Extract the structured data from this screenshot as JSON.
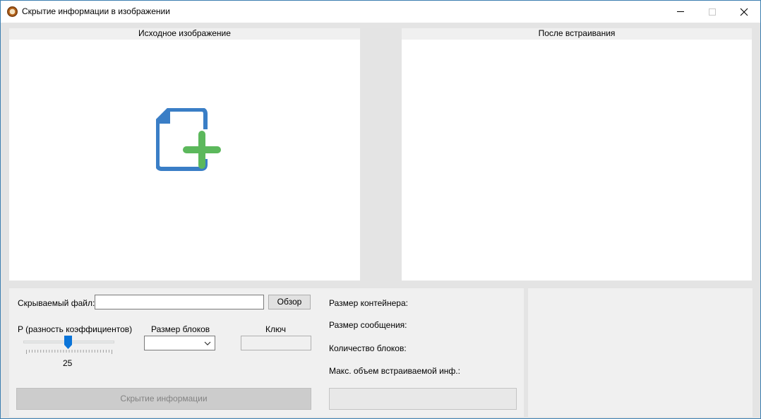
{
  "window": {
    "title": "Скрытие информации в изображении",
    "controls": {
      "minimize": "minimize",
      "maximize": "maximize",
      "close": "close"
    }
  },
  "source_image": {
    "header": "Исходное изображение",
    "icon": "add-file-icon"
  },
  "result_image": {
    "header": "После встраивания"
  },
  "controls_panel": {
    "hidden_file_label": "Скрываемый файл:",
    "hidden_file_value": "",
    "browse_label": "Обзор",
    "p_label": "P (разность коэффициентов)",
    "p_value": "25",
    "p_fraction": 0.5,
    "block_size_label": "Размер блоков",
    "block_size_value": "",
    "key_label": "Ключ",
    "key_value": "",
    "hide_button_label": "Скрытие информации"
  },
  "info_panel": {
    "container_size_label": "Размер контейнера:",
    "message_size_label": "Размер сообщения:",
    "block_count_label": "Количество блоков:",
    "max_capacity_label": "Макс. объем встраиваемой инф.:"
  },
  "colors": {
    "file_icon_blue": "#3a7ec6",
    "plus_green": "#5cb85c",
    "slider_thumb": "#0a74d8"
  }
}
